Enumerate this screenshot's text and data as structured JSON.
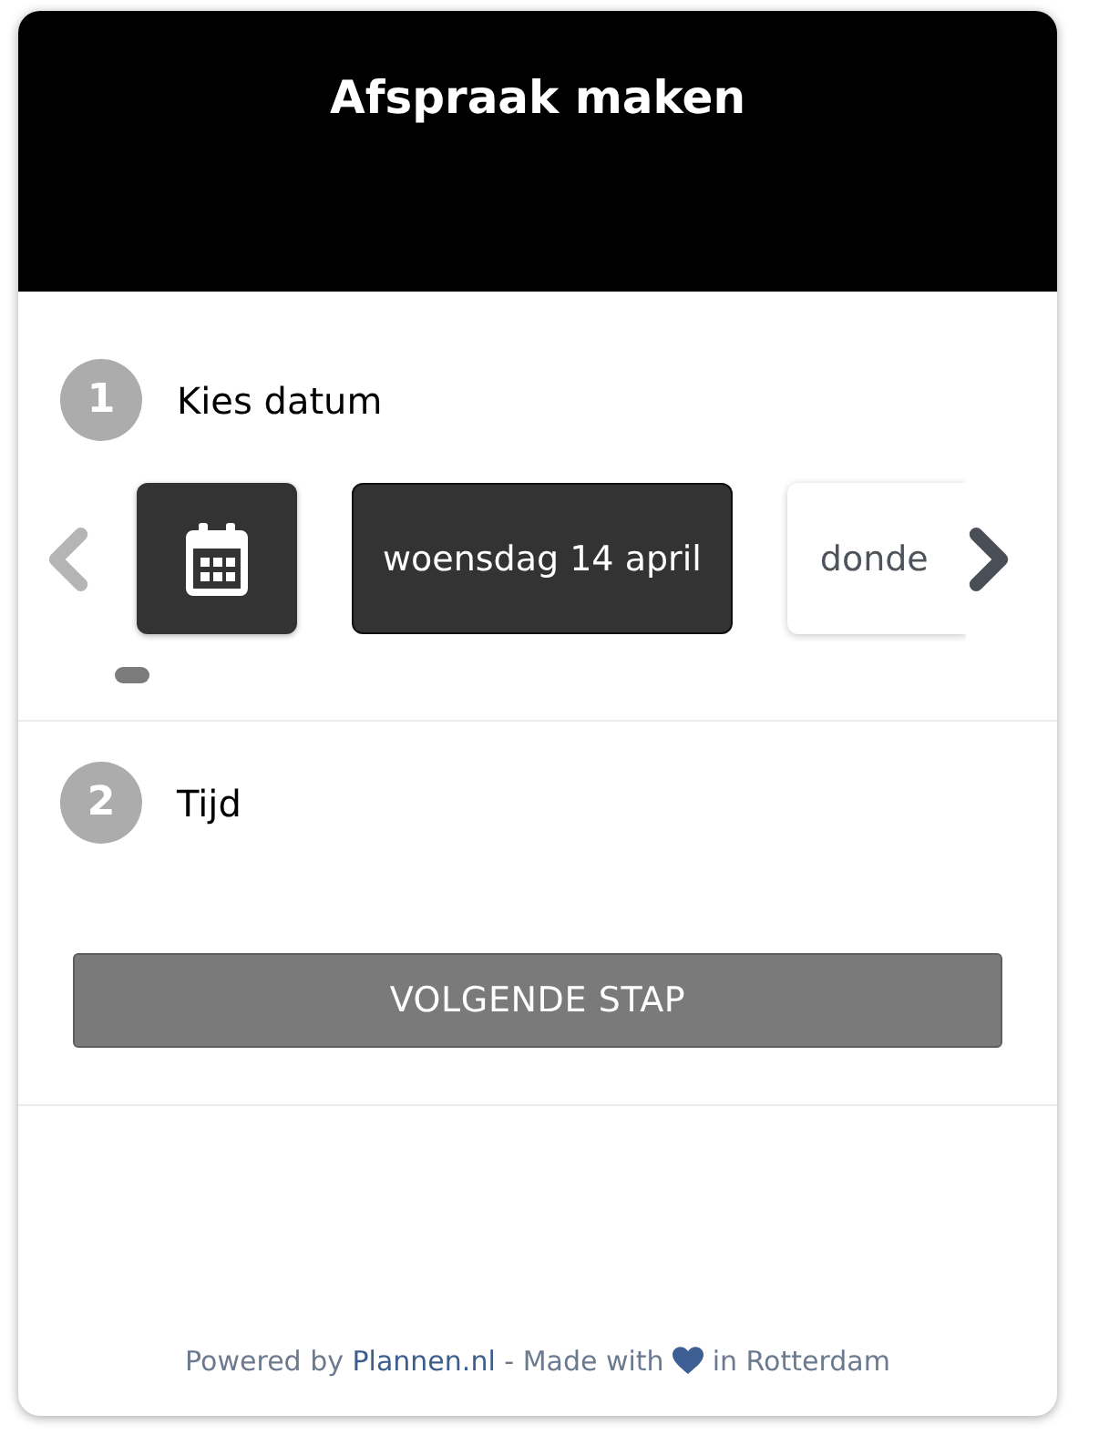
{
  "header": {
    "title": "Afspraak maken"
  },
  "steps": [
    {
      "number": "1",
      "label": "Kies datum",
      "date_picker": {
        "prev_button": {
          "disabled": true
        },
        "next_button": {
          "disabled": false
        },
        "dates": [
          {
            "label": "woensdag 14 april",
            "selected": true
          },
          {
            "label": "donde",
            "selected": false
          }
        ]
      }
    },
    {
      "number": "2",
      "label": "Tijd"
    }
  ],
  "next_step_button": {
    "label": "VOLGENDE STAP",
    "disabled": true
  },
  "footer": {
    "before_link": "Powered by",
    "link": "Plannen.nl",
    "after_link": "- Made with",
    "after_heart": "in Rotterdam"
  }
}
